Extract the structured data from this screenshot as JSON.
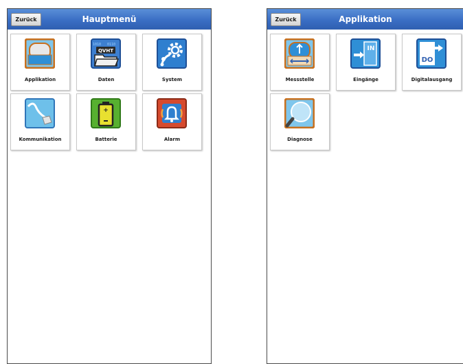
{
  "left_screen": {
    "back_label": "Zurück",
    "title": "Hauptmenü",
    "tiles": [
      {
        "label": "Applikation",
        "icon": "application-icon"
      },
      {
        "label": "Daten",
        "icon": "data-folder-icon"
      },
      {
        "label": "System",
        "icon": "system-gear-icon"
      },
      {
        "label": "Kommunikation",
        "icon": "communication-cable-icon"
      },
      {
        "label": "Batterie",
        "icon": "battery-icon"
      },
      {
        "label": "Alarm",
        "icon": "alarm-bell-icon"
      }
    ]
  },
  "right_screen": {
    "back_label": "Zurück",
    "title": "Applikation",
    "tiles": [
      {
        "label": "Messstelle",
        "icon": "measuring-point-icon"
      },
      {
        "label": "Eingänge",
        "icon": "inputs-icon"
      },
      {
        "label": "Digitalausgang",
        "icon": "digital-output-icon"
      },
      {
        "label": "Diagnose",
        "icon": "diagnosis-magnifier-icon"
      }
    ]
  },
  "icon_texts": {
    "data_badge": "QVHT",
    "inputs_badge": "IN",
    "digital_output_badge": "DO"
  },
  "colors": {
    "header_blue": "#3a6ec4",
    "orange_frame": "#d9822b",
    "blue_fill": "#2f8fd6",
    "battery_green": "#57b030"
  }
}
